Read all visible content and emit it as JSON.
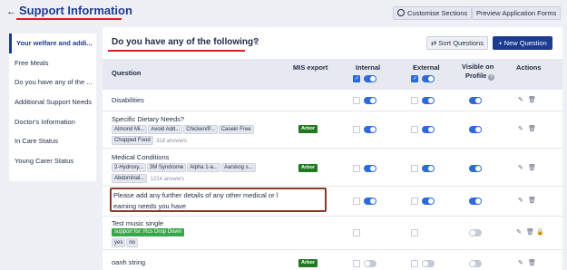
{
  "header": {
    "back": "←",
    "title": "Support Information",
    "customise_label": "Customise Sections",
    "preview_label": "Preview Application Forms"
  },
  "sidebar": {
    "items": [
      {
        "label": "Your welfare and addi..."
      },
      {
        "label": "Free Meals"
      },
      {
        "label": "Do you have any of the ..."
      },
      {
        "label": "Additional Support Needs"
      },
      {
        "label": "Doctor's Information"
      },
      {
        "label": "In Care Status"
      },
      {
        "label": "Young Carer Status"
      }
    ]
  },
  "section": {
    "title": "Do you have any of the following?",
    "sort_label": "Sort Questions",
    "new_label": "New Question"
  },
  "table": {
    "headers": {
      "question": "Question",
      "mis": "MIS export",
      "internal": "Internal",
      "external": "External",
      "visible_line1": "Visible on",
      "visible_line2": "Profile",
      "actions": "Actions"
    },
    "rows": [
      {
        "question": "Disabilities"
      },
      {
        "question": "Specific Dietary Needs?",
        "tags": [
          "Almond Mi...",
          "Avoid Add...",
          "Chicken/P...",
          "Casein Free",
          "Chopped Food"
        ],
        "count": "318 answers",
        "mis": "Arbor"
      },
      {
        "question": "Medical Conditions",
        "tags": [
          "2-Hydroxy...",
          "3M Syndrome",
          "Alpha 1-a...",
          "Aarskog s...",
          "Abdominal..."
        ],
        "count": "1224 answers",
        "mis": "Arbor"
      },
      {
        "question_line1": "Please add any further details of any other medical or l",
        "question_line2": "earning needs you have"
      },
      {
        "question": "Test music single",
        "support": "support for: Rcs Drop Down",
        "tags": [
          "yes",
          "no"
        ]
      },
      {
        "question": "oanh string",
        "mis": "Arbor"
      }
    ]
  },
  "colors": {
    "brand": "#1d3b8f",
    "accent_red": "#d61f26",
    "toggle_on": "#2e6bd8",
    "arbor_green": "#1f7a1f",
    "support_green": "#3aa64a"
  }
}
